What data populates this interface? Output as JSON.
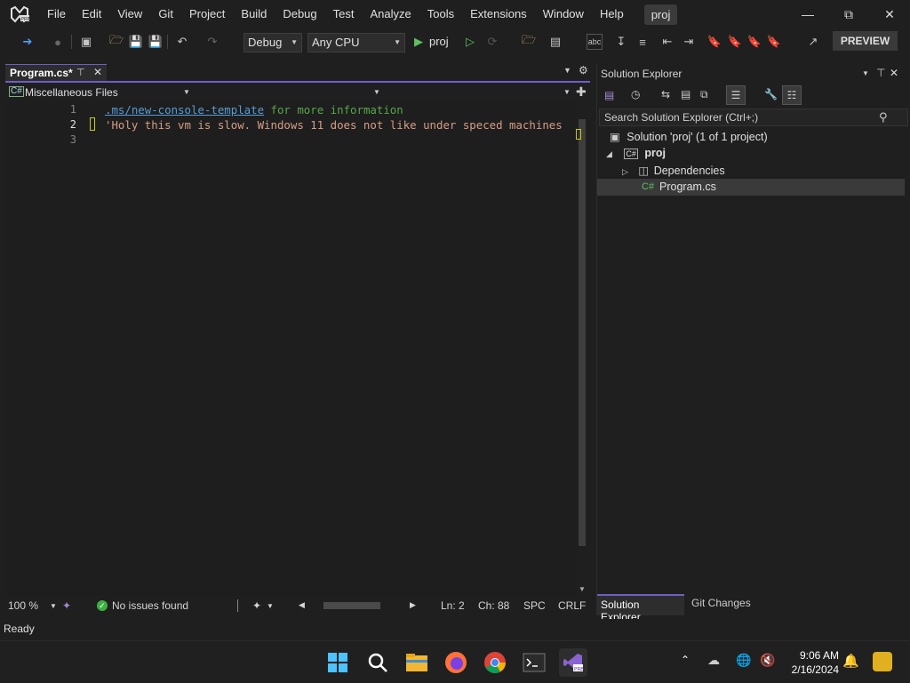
{
  "menu": [
    "File",
    "Edit",
    "View",
    "Git",
    "Project",
    "Build",
    "Debug",
    "Test",
    "Analyze",
    "Tools",
    "Extensions",
    "Window",
    "Help"
  ],
  "project_badge": "proj",
  "toolbar": {
    "config": "Debug",
    "platform": "Any CPU",
    "start_target": "proj",
    "preview_label": "PREVIEW"
  },
  "editor": {
    "tab_label": "Program.cs*",
    "nav_scope": "Miscellaneous Files",
    "lines": [
      {
        "num": "1",
        "link": ".ms/new-console-template",
        "comment": " for more information"
      },
      {
        "num": "2",
        "string": "'Holy this vm is slow. Windows 11 does not like under speced machines"
      },
      {
        "num": "3"
      }
    ]
  },
  "editor_status": {
    "zoom": "100 %",
    "issues": "No issues found",
    "ln": "Ln: 2",
    "ch": "Ch: 88",
    "spc": "SPC",
    "eol": "CRLF"
  },
  "solution_explorer": {
    "title": "Solution Explorer",
    "search_placeholder": "Search Solution Explorer (Ctrl+;)",
    "solution_label": "Solution 'proj' (1 of 1 project)",
    "project_label": "proj",
    "dependencies_label": "Dependencies",
    "file_label": "Program.cs",
    "bottom_tabs": [
      "Solution Explorer",
      "Git Changes"
    ]
  },
  "status": "Ready",
  "clock": {
    "time": "9:06 AM",
    "date": "2/16/2024"
  },
  "colors": {
    "accent": "#6e5ec7",
    "link": "#569cd6",
    "comment": "#57a64a",
    "string": "#d69d85"
  }
}
